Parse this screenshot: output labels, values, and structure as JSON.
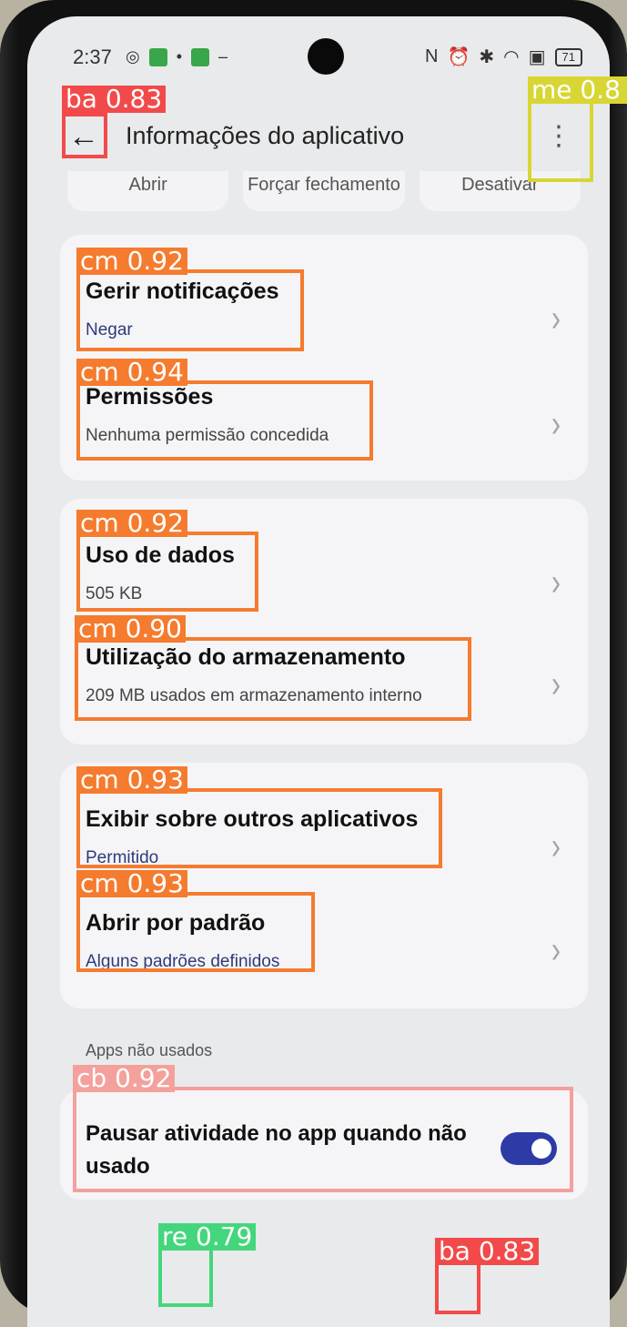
{
  "status_bar": {
    "time": "2:37",
    "battery": "71"
  },
  "app_bar": {
    "title": "Informações do aplicativo",
    "back_icon": "arrow-left-icon",
    "menu_icon": "more-vert-icon"
  },
  "actions": [
    "Abrir",
    "Forçar fechamento",
    "Desativar"
  ],
  "cards": [
    {
      "rows": [
        {
          "title": "Gerir notificações",
          "subtitle": "Negar",
          "subtitle_color": "#2f3a7a"
        },
        {
          "title": "Permissões",
          "subtitle": "Nenhuma permissão concedida",
          "subtitle_color": "#444444"
        }
      ]
    },
    {
      "rows": [
        {
          "title": "Uso de dados",
          "subtitle": "505 KB",
          "subtitle_color": "#444444"
        },
        {
          "title": "Utilização do armazenamento",
          "subtitle": "209 MB usados em armazenamento interno",
          "subtitle_color": "#444444"
        }
      ]
    },
    {
      "rows": [
        {
          "title": "Exibir sobre outros aplicativos",
          "subtitle": "Permitido",
          "subtitle_color": "#2f3a7a"
        },
        {
          "title": "Abrir por padrão",
          "subtitle": "Alguns padrões definidos",
          "subtitle_color": "#2f3a7a"
        }
      ]
    }
  ],
  "unused_apps": {
    "section_label": "Apps não usados",
    "toggle_label": "Pausar atividade no app quando não usado",
    "toggle_on": true
  },
  "detections": [
    {
      "label": "ba 0.83",
      "color": "#f24a4a"
    },
    {
      "label": "me 0.8",
      "color": "#d7d634"
    },
    {
      "label": "cm 0.92",
      "color": "#f57b2e"
    },
    {
      "label": "cm 0.94",
      "color": "#f57b2e"
    },
    {
      "label": "cm 0.92",
      "color": "#f57b2e"
    },
    {
      "label": "cm 0.90",
      "color": "#f57b2e"
    },
    {
      "label": "cm 0.93",
      "color": "#f57b2e"
    },
    {
      "label": "cm 0.93",
      "color": "#f57b2e"
    },
    {
      "label": "cb 0.92",
      "color": "#f4a09c"
    },
    {
      "label": "re 0.79",
      "color": "#43d67d"
    },
    {
      "label": "ba 0.83",
      "color": "#f24a4a"
    }
  ]
}
